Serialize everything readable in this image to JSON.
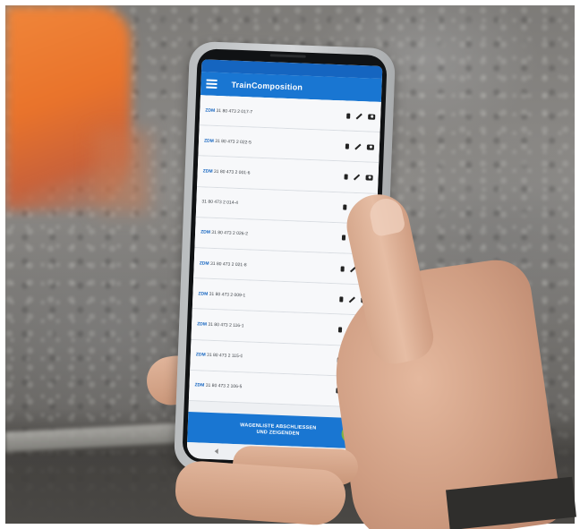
{
  "app": {
    "title": "TrainComposition"
  },
  "wagons": [
    {
      "tag": "ZDM",
      "number": "31 80 473 2 017-7"
    },
    {
      "tag": "ZDM",
      "number": "31 80 473 2 022-5"
    },
    {
      "tag": "ZDM",
      "number": "31 80 473 2 001-6"
    },
    {
      "tag": "",
      "number": "31 80 473 2 014-4"
    },
    {
      "tag": "ZDM",
      "number": "31 80 473 2 026-2"
    },
    {
      "tag": "ZDM",
      "number": "31 80 473 2 021-8"
    },
    {
      "tag": "ZDM",
      "number": "31 80 473 2 009-1"
    },
    {
      "tag": "ZDM",
      "number": "31 80 473 2 116-1"
    },
    {
      "tag": "ZDM",
      "number": "31 80 473 2 115-0"
    },
    {
      "tag": "ZDM",
      "number": "31 80 473 2 106-5"
    }
  ],
  "bottom_button": {
    "line1": "WAGENLISTE ABSCHLIESSEN",
    "line2": "UND ZEIGENDEN"
  },
  "icons": {
    "menu": "menu-icon",
    "delete": "trash-icon",
    "edit": "pencil-icon",
    "photo": "camera-icon",
    "confirm": "check-icon"
  },
  "colors": {
    "app_bar": "#1976d2",
    "fab": "#7cb342"
  }
}
